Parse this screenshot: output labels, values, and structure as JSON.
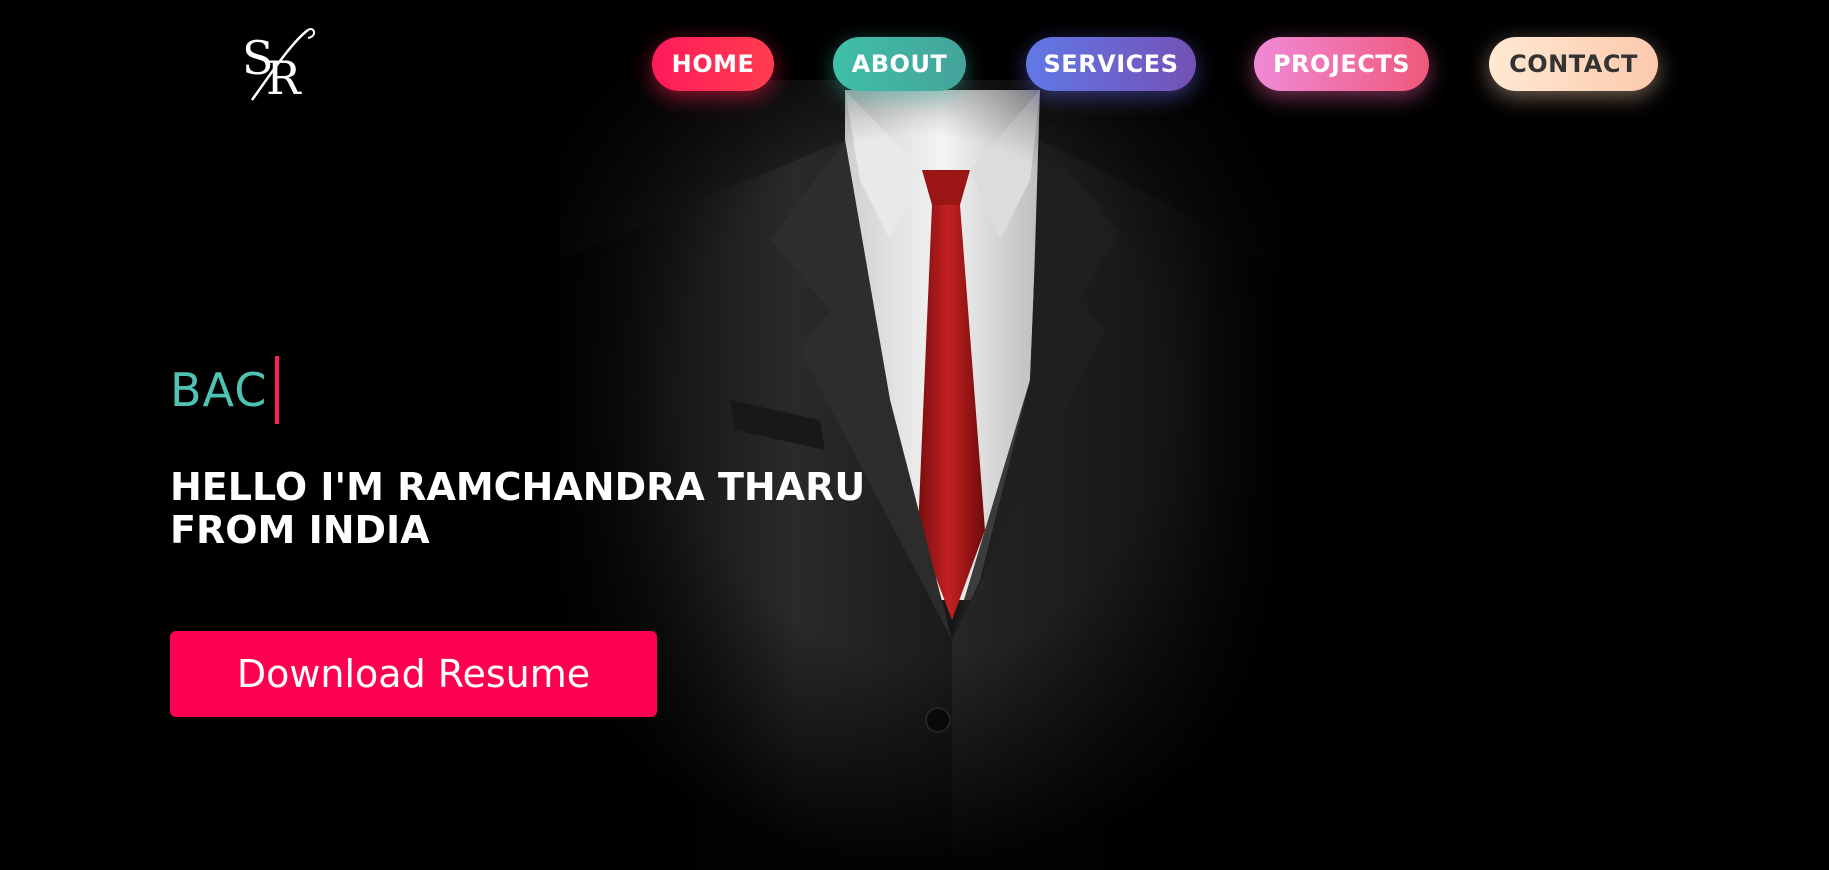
{
  "logo": {
    "text": "SR",
    "icon": "sr-monogram-logo"
  },
  "nav": {
    "items": [
      {
        "label": "HOME",
        "color_from": "#ff1a5a",
        "color_to": "#ff3d4f"
      },
      {
        "label": "ABOUT",
        "color_from": "#3fbfa9",
        "color_to": "#45a39a"
      },
      {
        "label": "SERVICES",
        "color_from": "#6178e6",
        "color_to": "#7451b6"
      },
      {
        "label": "PROJECTS",
        "color_from": "#f08ad8",
        "color_to": "#f0587a"
      },
      {
        "label": "CONTACT",
        "color_from": "#ffe9d2",
        "color_to": "#fcc9ac"
      }
    ]
  },
  "hero": {
    "typed_text": "BAC",
    "greeting_line1": "HELLO I'M RAMCHANDRA THARU",
    "greeting_line2": "FROM INDIA",
    "button_label": "Download Resume",
    "image": "suit-with-red-tie-image"
  },
  "colors": {
    "background": "#000000",
    "accent_teal": "#4ec3b3",
    "accent_pink": "#ff0050",
    "tie_red": "#b51c1c"
  }
}
